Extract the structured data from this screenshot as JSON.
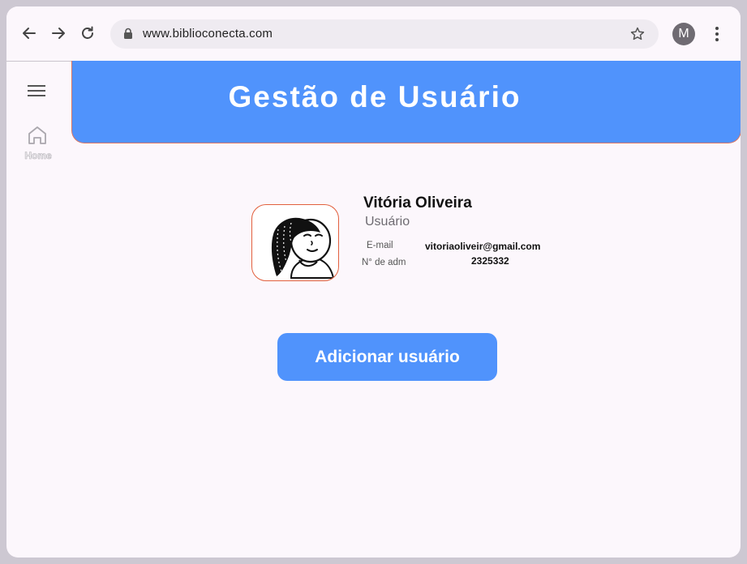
{
  "browser": {
    "url": "www.biblioconecta.com",
    "profile_initial": "M"
  },
  "sidebar": {
    "home_label": "Home"
  },
  "header": {
    "title": "Gestão de Usuário"
  },
  "profile": {
    "name": "Vitória Oliveira",
    "role": "Usuário",
    "email_label": "E-mail",
    "email_value": "vitoriaoliveir@gmail.com",
    "adm_label": "N° de adm",
    "adm_value": "2325332"
  },
  "actions": {
    "add_user_label": "Adicionar usuário"
  },
  "colors": {
    "accent": "#5093fc",
    "photo_border": "#e2603e",
    "background": "#fcf7fc"
  }
}
